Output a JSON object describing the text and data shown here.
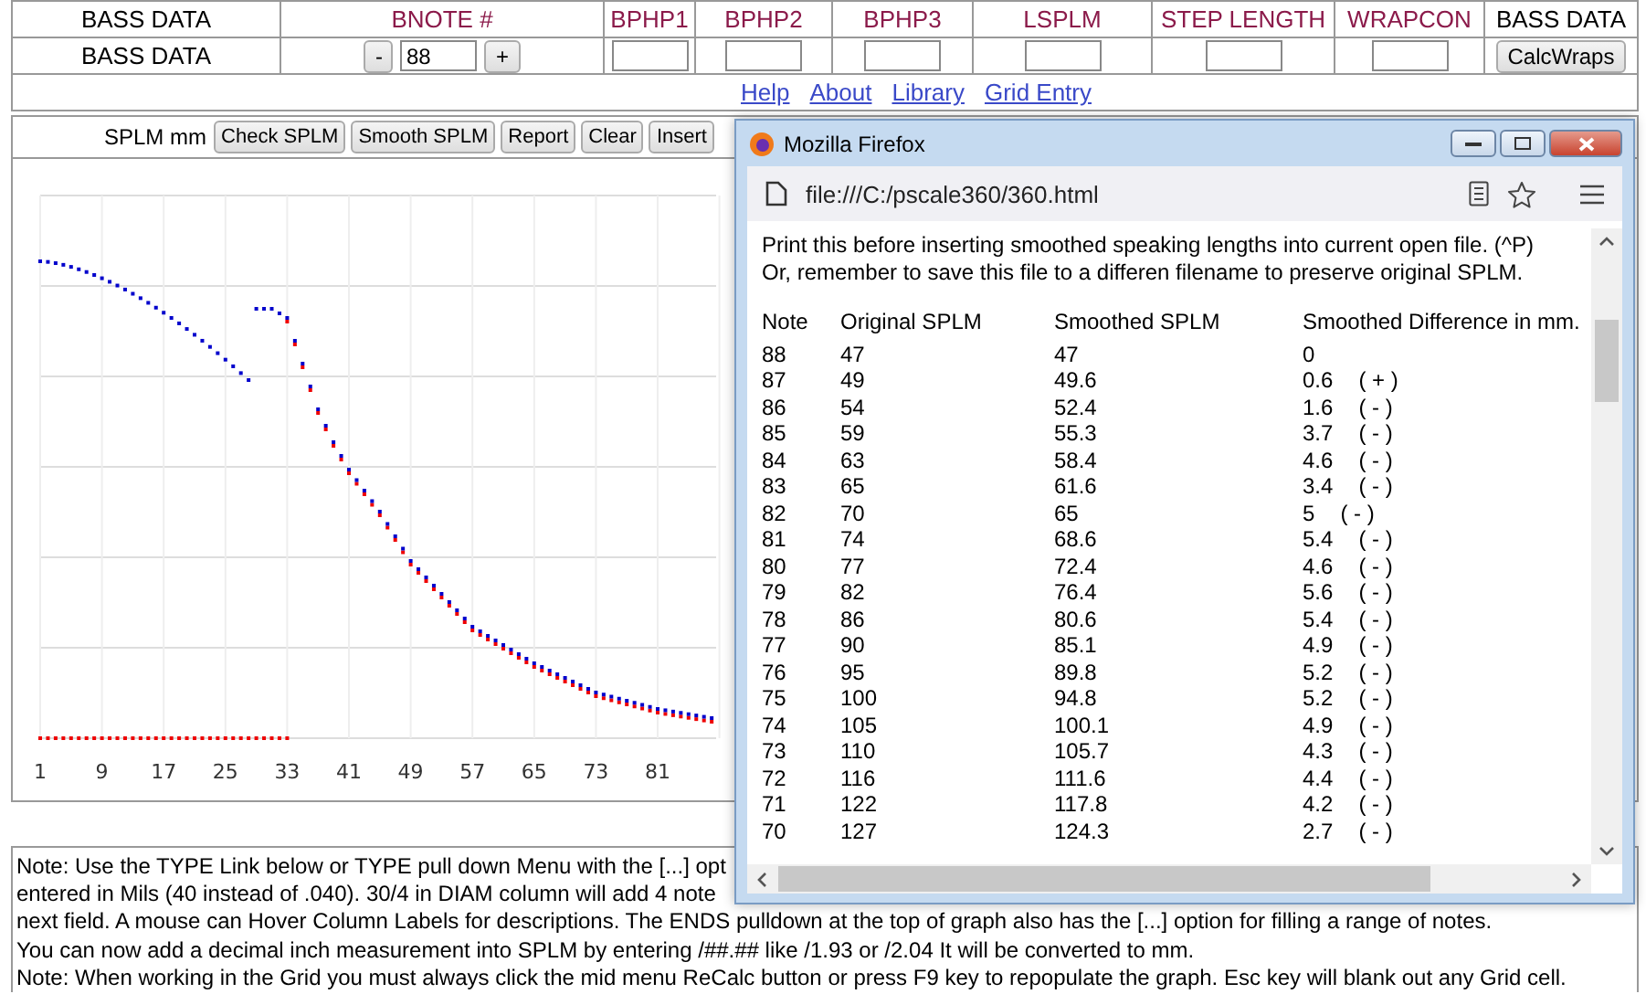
{
  "top_table": {
    "columns": [
      {
        "label": "BASS DATA",
        "kind": "plain"
      },
      {
        "label": "BNOTE #",
        "kind": "field"
      },
      {
        "label": "BPHP1",
        "kind": "field"
      },
      {
        "label": "BPHP2",
        "kind": "field"
      },
      {
        "label": "BPHP3",
        "kind": "field"
      },
      {
        "label": "LSPLM",
        "kind": "field"
      },
      {
        "label": "STEP LENGTH",
        "kind": "field"
      },
      {
        "label": "WRAPCON",
        "kind": "field"
      },
      {
        "label": "BASS DATA",
        "kind": "plain"
      }
    ],
    "cells": [
      {
        "kind": "text",
        "text": "BASS DATA"
      },
      {
        "kind": "stepper",
        "minus": "-",
        "value": "88",
        "plus": "+"
      },
      {
        "kind": "input"
      },
      {
        "kind": "input"
      },
      {
        "kind": "input"
      },
      {
        "kind": "input"
      },
      {
        "kind": "input"
      },
      {
        "kind": "input"
      },
      {
        "kind": "button",
        "label": "CalcWraps"
      }
    ]
  },
  "links": [
    "Help",
    "About",
    "Library",
    "Grid Entry"
  ],
  "graph": {
    "label": "SPLM mm",
    "buttons": [
      "Check SPLM",
      "Smooth SPLM",
      "Report",
      "Clear",
      "Insert"
    ],
    "x_axis_labels": [
      "1",
      "9",
      "17",
      "25",
      "33",
      "41",
      "49",
      "57",
      "65",
      "73",
      "81"
    ]
  },
  "notes": [
    "Note: Use the TYPE Link below or TYPE pull down Menu with the [...] opt",
    "entered in Mils (40 instead of .040). 30/4 in DIAM column will add 4 note",
    "next field. A mouse can Hover Column Labels for descriptions. The ENDS pulldown at the top of graph also has the [...] option for filling a range of notes.",
    "You can now add a decimal inch measurement into SPLM by entering /##.## like /1.93 or /2.04 It will be converted to mm.",
    "Note: When working in the Grid you must always click the mid menu ReCalc button or press F9 key to repopulate the graph. Esc key will blank out any Grid cell."
  ],
  "popup": {
    "title": "Mozilla Firefox",
    "url": "file:///C:/pscale360/360.html",
    "intro": [
      "Print this before inserting smoothed speaking lengths into current open file. (^P)",
      "Or, remember to save this file to a differen filename to preserve original SPLM."
    ],
    "columns": [
      "Note",
      "Original SPLM",
      "Smoothed SPLM",
      "Smoothed Difference in mm."
    ],
    "rows": [
      {
        "note": "88",
        "original": "47",
        "smoothed": "47",
        "difference": "0"
      },
      {
        "note": "87",
        "original": "49",
        "smoothed": "49.6",
        "difference": "0.6",
        "sign": "( + )"
      },
      {
        "note": "86",
        "original": "54",
        "smoothed": "52.4",
        "difference": "1.6",
        "sign": "( - )"
      },
      {
        "note": "85",
        "original": "59",
        "smoothed": "55.3",
        "difference": "3.7",
        "sign": "( - )"
      },
      {
        "note": "84",
        "original": "63",
        "smoothed": "58.4",
        "difference": "4.6",
        "sign": "( - )"
      },
      {
        "note": "83",
        "original": "65",
        "smoothed": "61.6",
        "difference": "3.4",
        "sign": "( - )"
      },
      {
        "note": "82",
        "original": "70",
        "smoothed": "65",
        "difference": "5",
        "sign": "( - )"
      },
      {
        "note": "81",
        "original": "74",
        "smoothed": "68.6",
        "difference": "5.4",
        "sign": "( - )"
      },
      {
        "note": "80",
        "original": "77",
        "smoothed": "72.4",
        "difference": "4.6",
        "sign": "( - )"
      },
      {
        "note": "79",
        "original": "82",
        "smoothed": "76.4",
        "difference": "5.6",
        "sign": "( - )"
      },
      {
        "note": "78",
        "original": "86",
        "smoothed": "80.6",
        "difference": "5.4",
        "sign": "( - )"
      },
      {
        "note": "77",
        "original": "90",
        "smoothed": "85.1",
        "difference": "4.9",
        "sign": "( - )"
      },
      {
        "note": "76",
        "original": "95",
        "smoothed": "89.8",
        "difference": "5.2",
        "sign": "( - )"
      },
      {
        "note": "75",
        "original": "100",
        "smoothed": "94.8",
        "difference": "5.2",
        "sign": "( - )"
      },
      {
        "note": "74",
        "original": "105",
        "smoothed": "100.1",
        "difference": "4.9",
        "sign": "( - )"
      },
      {
        "note": "73",
        "original": "110",
        "smoothed": "105.7",
        "difference": "4.3",
        "sign": "( - )"
      },
      {
        "note": "72",
        "original": "116",
        "smoothed": "111.6",
        "difference": "4.4",
        "sign": "( - )"
      },
      {
        "note": "71",
        "original": "122",
        "smoothed": "117.8",
        "difference": "4.2",
        "sign": "( - )"
      },
      {
        "note": "70",
        "original": "127",
        "smoothed": "124.3",
        "difference": "2.7",
        "sign": "( - )"
      }
    ]
  }
}
